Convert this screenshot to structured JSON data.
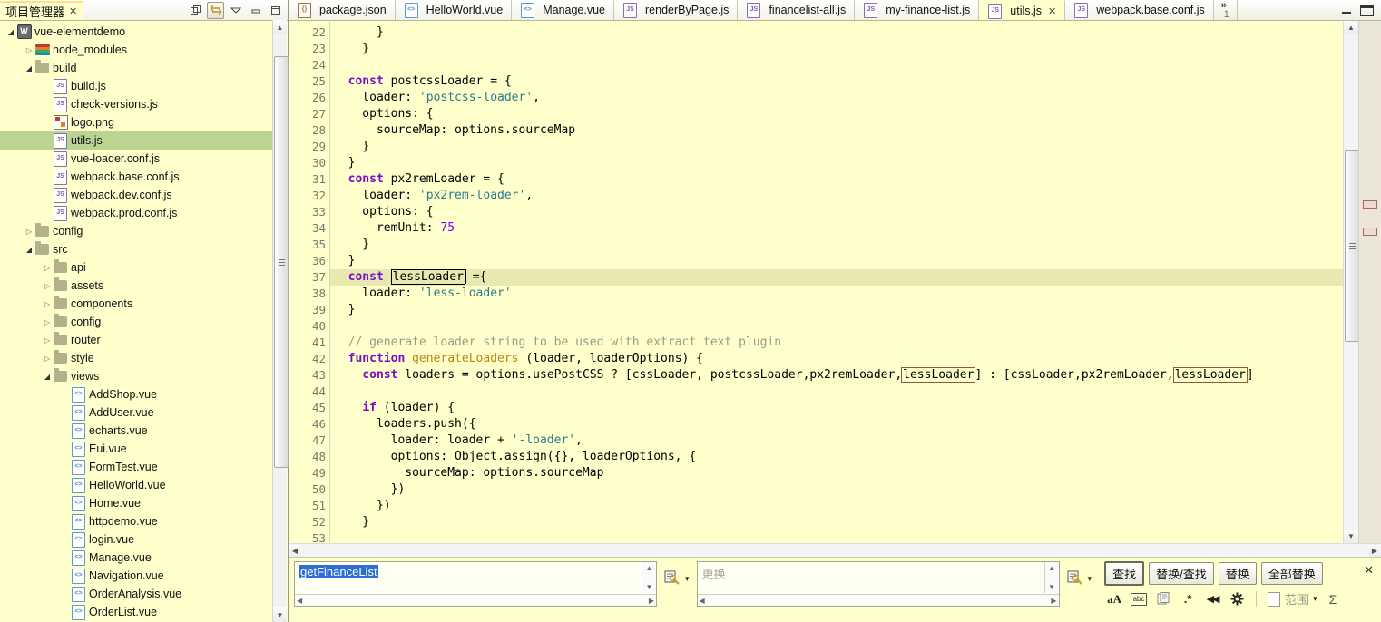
{
  "left_panel": {
    "tab_title": "项目管理器",
    "tab_close": "✕",
    "toolbar": [
      {
        "name": "collapse-all-icon",
        "glyph": "▤"
      },
      {
        "name": "link-with-editor-icon",
        "glyph": "↔"
      },
      {
        "name": "view-menu-icon",
        "glyph": "▽"
      },
      {
        "name": "minimize-icon",
        "glyph": "▬"
      },
      {
        "name": "maximize-icon",
        "glyph": "❐"
      }
    ],
    "tree": [
      {
        "label": "vue-elementdemo",
        "indent": 0,
        "twisty": "open",
        "icon": "project",
        "selected": false
      },
      {
        "label": "node_modules",
        "indent": 1,
        "twisty": "closed",
        "icon": "node",
        "selected": false
      },
      {
        "label": "build",
        "indent": 1,
        "twisty": "open",
        "icon": "folder",
        "selected": false
      },
      {
        "label": "build.js",
        "indent": 2,
        "twisty": "none",
        "icon": "js",
        "selected": false
      },
      {
        "label": "check-versions.js",
        "indent": 2,
        "twisty": "none",
        "icon": "js",
        "selected": false
      },
      {
        "label": "logo.png",
        "indent": 2,
        "twisty": "none",
        "icon": "png",
        "selected": false
      },
      {
        "label": "utils.js",
        "indent": 2,
        "twisty": "none",
        "icon": "js",
        "selected": true
      },
      {
        "label": "vue-loader.conf.js",
        "indent": 2,
        "twisty": "none",
        "icon": "js",
        "selected": false
      },
      {
        "label": "webpack.base.conf.js",
        "indent": 2,
        "twisty": "none",
        "icon": "js",
        "selected": false
      },
      {
        "label": "webpack.dev.conf.js",
        "indent": 2,
        "twisty": "none",
        "icon": "js",
        "selected": false
      },
      {
        "label": "webpack.prod.conf.js",
        "indent": 2,
        "twisty": "none",
        "icon": "js",
        "selected": false
      },
      {
        "label": "config",
        "indent": 1,
        "twisty": "closed",
        "icon": "folder",
        "selected": false
      },
      {
        "label": "src",
        "indent": 1,
        "twisty": "open",
        "icon": "folder",
        "selected": false
      },
      {
        "label": "api",
        "indent": 2,
        "twisty": "closed",
        "icon": "folder",
        "selected": false
      },
      {
        "label": "assets",
        "indent": 2,
        "twisty": "closed",
        "icon": "folder",
        "selected": false
      },
      {
        "label": "components",
        "indent": 2,
        "twisty": "closed",
        "icon": "folder",
        "selected": false
      },
      {
        "label": "config",
        "indent": 2,
        "twisty": "closed",
        "icon": "folder",
        "selected": false
      },
      {
        "label": "router",
        "indent": 2,
        "twisty": "closed",
        "icon": "folder",
        "selected": false
      },
      {
        "label": "style",
        "indent": 2,
        "twisty": "closed",
        "icon": "folder",
        "selected": false
      },
      {
        "label": "views",
        "indent": 2,
        "twisty": "open",
        "icon": "folder",
        "selected": false
      },
      {
        "label": "AddShop.vue",
        "indent": 3,
        "twisty": "none",
        "icon": "vue",
        "selected": false
      },
      {
        "label": "AddUser.vue",
        "indent": 3,
        "twisty": "none",
        "icon": "vue",
        "selected": false
      },
      {
        "label": "echarts.vue",
        "indent": 3,
        "twisty": "none",
        "icon": "vue",
        "selected": false
      },
      {
        "label": "Eui.vue",
        "indent": 3,
        "twisty": "none",
        "icon": "vue",
        "selected": false
      },
      {
        "label": "FormTest.vue",
        "indent": 3,
        "twisty": "none",
        "icon": "vue",
        "selected": false
      },
      {
        "label": "HelloWorld.vue",
        "indent": 3,
        "twisty": "none",
        "icon": "vue",
        "selected": false
      },
      {
        "label": "Home.vue",
        "indent": 3,
        "twisty": "none",
        "icon": "vue",
        "selected": false
      },
      {
        "label": "httpdemo.vue",
        "indent": 3,
        "twisty": "none",
        "icon": "vue",
        "selected": false
      },
      {
        "label": "login.vue",
        "indent": 3,
        "twisty": "none",
        "icon": "vue",
        "selected": false
      },
      {
        "label": "Manage.vue",
        "indent": 3,
        "twisty": "none",
        "icon": "vue",
        "selected": false
      },
      {
        "label": "Navigation.vue",
        "indent": 3,
        "twisty": "none",
        "icon": "vue",
        "selected": false
      },
      {
        "label": "OrderAnalysis.vue",
        "indent": 3,
        "twisty": "none",
        "icon": "vue",
        "selected": false
      },
      {
        "label": "OrderList.vue",
        "indent": 3,
        "twisty": "none",
        "icon": "vue",
        "selected": false
      }
    ]
  },
  "editor": {
    "tabs": [
      {
        "label": "package.json",
        "icon": "json",
        "active": false,
        "closable": false
      },
      {
        "label": "HelloWorld.vue",
        "icon": "vue",
        "active": false,
        "closable": false
      },
      {
        "label": "Manage.vue",
        "icon": "vue",
        "active": false,
        "closable": false
      },
      {
        "label": "renderByPage.js",
        "icon": "js",
        "active": false,
        "closable": false
      },
      {
        "label": "financelist-all.js",
        "icon": "js",
        "active": false,
        "closable": false
      },
      {
        "label": "my-finance-list.js",
        "icon": "js",
        "active": false,
        "closable": false
      },
      {
        "label": "utils.js",
        "icon": "js",
        "active": true,
        "closable": true
      },
      {
        "label": "webpack.base.conf.js",
        "icon": "js",
        "active": false,
        "closable": false
      }
    ],
    "tab_close_glyph": "✕",
    "overflow_chevron": "»",
    "overflow_count": "1",
    "window_buttons": [
      {
        "name": "editor-minimize-icon"
      },
      {
        "name": "editor-maximize-icon"
      }
    ],
    "first_line_number": 22,
    "lines": [
      {
        "n": 22,
        "fold": false,
        "hl": false,
        "tokens": [
          {
            "t": "      }",
            "c": "pl"
          }
        ]
      },
      {
        "n": 23,
        "fold": false,
        "hl": false,
        "tokens": [
          {
            "t": "    }",
            "c": "pl"
          }
        ]
      },
      {
        "n": 24,
        "fold": false,
        "hl": false,
        "tokens": [
          {
            "t": "",
            "c": "pl"
          }
        ]
      },
      {
        "n": 25,
        "fold": true,
        "hl": false,
        "tokens": [
          {
            "t": "  ",
            "c": "pl"
          },
          {
            "t": "const",
            "c": "kw"
          },
          {
            "t": " postcssLoader = {",
            "c": "pl"
          }
        ]
      },
      {
        "n": 26,
        "fold": false,
        "hl": false,
        "tokens": [
          {
            "t": "    loader: ",
            "c": "pl"
          },
          {
            "t": "'postcss-loader'",
            "c": "str"
          },
          {
            "t": ",",
            "c": "pl"
          }
        ]
      },
      {
        "n": 27,
        "fold": true,
        "hl": false,
        "tokens": [
          {
            "t": "    options: {",
            "c": "pl"
          }
        ]
      },
      {
        "n": 28,
        "fold": false,
        "hl": false,
        "tokens": [
          {
            "t": "      sourceMap: options.sourceMap",
            "c": "pl"
          }
        ]
      },
      {
        "n": 29,
        "fold": false,
        "hl": false,
        "tokens": [
          {
            "t": "    }",
            "c": "pl"
          }
        ]
      },
      {
        "n": 30,
        "fold": false,
        "hl": false,
        "tokens": [
          {
            "t": "  }",
            "c": "pl"
          }
        ]
      },
      {
        "n": 31,
        "fold": true,
        "hl": false,
        "tokens": [
          {
            "t": "  ",
            "c": "pl"
          },
          {
            "t": "const",
            "c": "kw"
          },
          {
            "t": " px2remLoader = {",
            "c": "pl"
          }
        ]
      },
      {
        "n": 32,
        "fold": false,
        "hl": false,
        "tokens": [
          {
            "t": "    loader: ",
            "c": "pl"
          },
          {
            "t": "'px2rem-loader'",
            "c": "str"
          },
          {
            "t": ",",
            "c": "pl"
          }
        ]
      },
      {
        "n": 33,
        "fold": true,
        "hl": false,
        "tokens": [
          {
            "t": "    options: {",
            "c": "pl"
          }
        ]
      },
      {
        "n": 34,
        "fold": false,
        "hl": false,
        "tokens": [
          {
            "t": "      remUnit: ",
            "c": "pl"
          },
          {
            "t": "75",
            "c": "num"
          }
        ]
      },
      {
        "n": 35,
        "fold": false,
        "hl": false,
        "tokens": [
          {
            "t": "    }",
            "c": "pl"
          }
        ]
      },
      {
        "n": 36,
        "fold": false,
        "hl": false,
        "tokens": [
          {
            "t": "  }",
            "c": "pl"
          }
        ]
      },
      {
        "n": 37,
        "fold": true,
        "hl": true,
        "tokens": [
          {
            "t": "  ",
            "c": "pl"
          },
          {
            "t": "const",
            "c": "kw"
          },
          {
            "t": " ",
            "c": "pl"
          },
          {
            "t": "lessLoader",
            "c": "cursor"
          },
          {
            "t": " ={",
            "c": "pl"
          }
        ]
      },
      {
        "n": 38,
        "fold": false,
        "hl": false,
        "tokens": [
          {
            "t": "    loader: ",
            "c": "pl"
          },
          {
            "t": "'less-loader'",
            "c": "str"
          }
        ]
      },
      {
        "n": 39,
        "fold": false,
        "hl": false,
        "tokens": [
          {
            "t": "  }",
            "c": "pl"
          }
        ]
      },
      {
        "n": 40,
        "fold": false,
        "hl": false,
        "tokens": [
          {
            "t": "",
            "c": "pl"
          }
        ]
      },
      {
        "n": 41,
        "fold": false,
        "hl": false,
        "tokens": [
          {
            "t": "  // generate loader string to be used with extract text plugin",
            "c": "cmt"
          }
        ]
      },
      {
        "n": 42,
        "fold": true,
        "hl": false,
        "tokens": [
          {
            "t": "  ",
            "c": "pl"
          },
          {
            "t": "function",
            "c": "kw"
          },
          {
            "t": " ",
            "c": "pl"
          },
          {
            "t": "generateLoaders",
            "c": "fn"
          },
          {
            "t": " (loader, loaderOptions) {",
            "c": "pl"
          }
        ]
      },
      {
        "n": 43,
        "fold": false,
        "hl": false,
        "tokens": [
          {
            "t": "    ",
            "c": "pl"
          },
          {
            "t": "const",
            "c": "kw"
          },
          {
            "t": " loaders = options.usePostCSS ? [cssLoader, postcssLoader,px2remLoader,",
            "c": "pl"
          },
          {
            "t": "lessLoader",
            "c": "occ"
          },
          {
            "t": "] : [cssLoader,px2remLoader,",
            "c": "pl"
          },
          {
            "t": "lessLoader",
            "c": "occ"
          },
          {
            "t": "]",
            "c": "pl"
          }
        ]
      },
      {
        "n": 44,
        "fold": false,
        "hl": false,
        "tokens": [
          {
            "t": "",
            "c": "pl"
          }
        ]
      },
      {
        "n": 45,
        "fold": true,
        "hl": false,
        "tokens": [
          {
            "t": "    ",
            "c": "pl"
          },
          {
            "t": "if",
            "c": "kw"
          },
          {
            "t": " (loader) {",
            "c": "pl"
          }
        ]
      },
      {
        "n": 46,
        "fold": true,
        "hl": false,
        "tokens": [
          {
            "t": "      loaders.push({",
            "c": "pl"
          }
        ]
      },
      {
        "n": 47,
        "fold": false,
        "hl": false,
        "tokens": [
          {
            "t": "        loader: loader + ",
            "c": "pl"
          },
          {
            "t": "'-loader'",
            "c": "str"
          },
          {
            "t": ",",
            "c": "pl"
          }
        ]
      },
      {
        "n": 48,
        "fold": true,
        "hl": false,
        "tokens": [
          {
            "t": "        options: Object.assign({}, loaderOptions, {",
            "c": "pl"
          }
        ]
      },
      {
        "n": 49,
        "fold": false,
        "hl": false,
        "tokens": [
          {
            "t": "          sourceMap: options.sourceMap",
            "c": "pl"
          }
        ]
      },
      {
        "n": 50,
        "fold": false,
        "hl": false,
        "tokens": [
          {
            "t": "        })",
            "c": "pl"
          }
        ]
      },
      {
        "n": 51,
        "fold": false,
        "hl": false,
        "tokens": [
          {
            "t": "      })",
            "c": "pl"
          }
        ]
      },
      {
        "n": 52,
        "fold": false,
        "hl": false,
        "tokens": [
          {
            "t": "    }",
            "c": "pl"
          }
        ]
      },
      {
        "n": 53,
        "fold": false,
        "hl": false,
        "tokens": [
          {
            "t": "",
            "c": "pl"
          }
        ]
      }
    ],
    "overview_markers": [
      198,
      228
    ]
  },
  "find_bar": {
    "find_value": "getFinanceList",
    "find_placeholder": "查找",
    "replace_value": "",
    "replace_placeholder": "更换",
    "buttons": [
      {
        "label": "查找",
        "name": "find-button",
        "primary": true
      },
      {
        "label": "替换/查找",
        "name": "replace-find-button",
        "primary": false
      },
      {
        "label": "替换",
        "name": "replace-button",
        "primary": false
      },
      {
        "label": "全部替换",
        "name": "replace-all-button",
        "primary": false
      }
    ],
    "option_icons": [
      {
        "name": "case-sensitive-icon",
        "glyph": "aA"
      },
      {
        "name": "whole-word-icon",
        "glyph": "abc"
      },
      {
        "name": "wrap-search-icon",
        "glyph": "▤"
      },
      {
        "name": "regex-icon",
        "glyph": ".*"
      },
      {
        "name": "search-backward-icon",
        "glyph": "◀◀"
      },
      {
        "name": "search-settings-icon",
        "glyph": "✿"
      }
    ],
    "scope_label": "范围",
    "scope_caret": "▾",
    "sigma_glyph": "Σ",
    "close_glyph": "✕",
    "history_caret": "▾"
  },
  "colors": {
    "editor_bg": "#ffffcc",
    "selection_line": "#e8e8b0",
    "tree_selection": "#bcd492",
    "keyword": "#7a0cc6",
    "string": "#2a7a8c",
    "number": "#8000ff",
    "comment": "#9a9a8a",
    "function": "#b8860b",
    "occurrence_box": "#8a5a3a",
    "find_selection": "#2c6fd4"
  }
}
